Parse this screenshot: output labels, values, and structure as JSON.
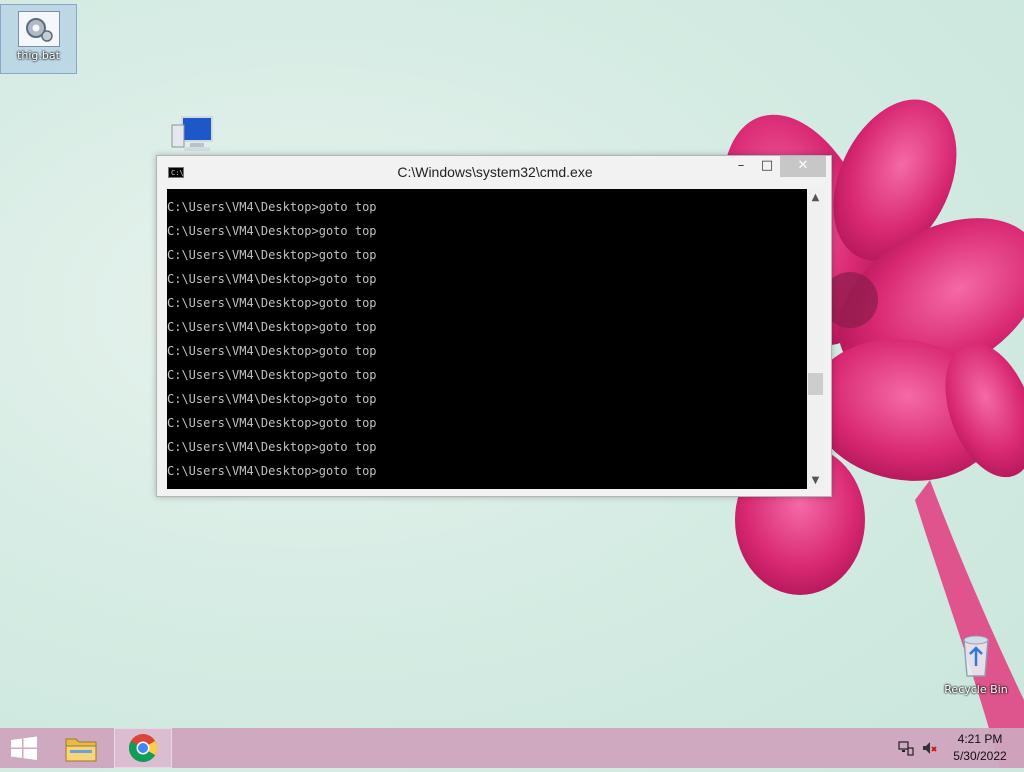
{
  "desktop": {
    "icons": [
      {
        "label": "thig.bat",
        "icon": "batch-file-icon"
      },
      {
        "label": "Recycle Bin",
        "icon": "recycle-bin-icon"
      },
      {
        "label": "",
        "icon": "computer-icon"
      }
    ]
  },
  "cmd_window": {
    "title": "C:\\Windows\\system32\\cmd.exe",
    "icon_text": "C:\\",
    "controls": {
      "minimize": "–",
      "maximize": "□",
      "close": "✕"
    },
    "lines": [
      "C:\\Users\\VM4\\Desktop>goto top",
      "C:\\Users\\VM4\\Desktop>goto top",
      "C:\\Users\\VM4\\Desktop>goto top",
      "C:\\Users\\VM4\\Desktop>goto top",
      "C:\\Users\\VM4\\Desktop>goto top",
      "C:\\Users\\VM4\\Desktop>goto top",
      "C:\\Users\\VM4\\Desktop>goto top",
      "C:\\Users\\VM4\\Desktop>goto top",
      "C:\\Users\\VM4\\Desktop>goto top",
      "C:\\Users\\VM4\\Desktop>goto top",
      "C:\\Users\\VM4\\Desktop>goto top",
      "C:\\Users\\VM4\\Desktop>goto top"
    ],
    "scroll": {
      "up": "▲",
      "down": "▼"
    }
  },
  "taskbar": {
    "items": [
      {
        "name": "start",
        "icon": "windows-logo-icon"
      },
      {
        "name": "file-explorer",
        "icon": "folder-icon"
      },
      {
        "name": "chrome",
        "icon": "chrome-icon"
      }
    ],
    "tray": {
      "network_icon": "network-icon",
      "volume_icon": "volume-muted-icon",
      "time": "4:21 PM",
      "date": "5/30/2022"
    }
  },
  "colors": {
    "console_bg": "#000000",
    "console_text": "#c0c0c0",
    "taskbar": "#cda5be",
    "flower": "#e0307a"
  }
}
